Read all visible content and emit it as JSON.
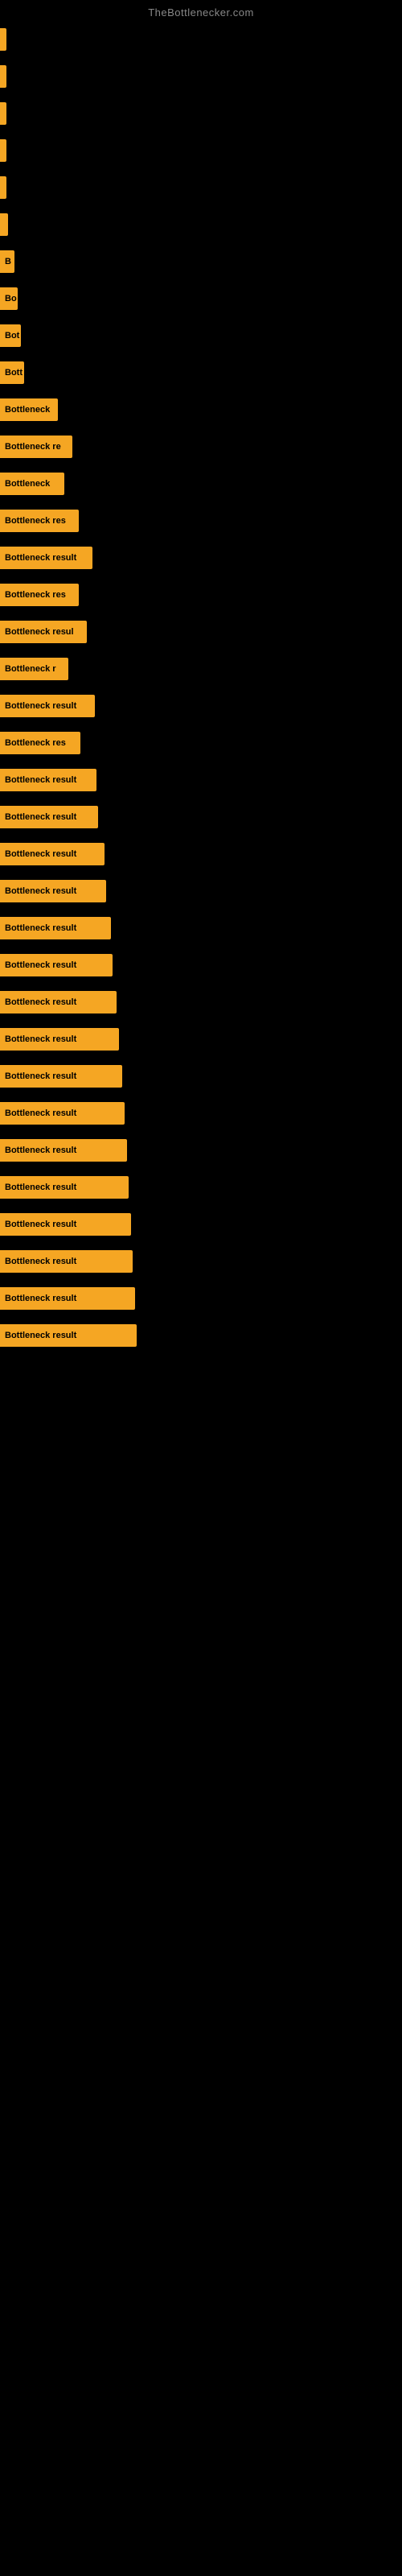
{
  "site": {
    "title": "TheBottlenecker.com"
  },
  "bars": [
    {
      "label": "",
      "width": 8
    },
    {
      "label": "",
      "width": 8
    },
    {
      "label": "",
      "width": 8
    },
    {
      "label": "",
      "width": 8
    },
    {
      "label": "",
      "width": 8
    },
    {
      "label": "",
      "width": 10
    },
    {
      "label": "B",
      "width": 18
    },
    {
      "label": "Bo",
      "width": 22
    },
    {
      "label": "Bot",
      "width": 26
    },
    {
      "label": "Bott",
      "width": 30
    },
    {
      "label": "Bottleneck",
      "width": 72
    },
    {
      "label": "Bottleneck re",
      "width": 90
    },
    {
      "label": "Bottleneck",
      "width": 80
    },
    {
      "label": "Bottleneck res",
      "width": 98
    },
    {
      "label": "Bottleneck result",
      "width": 115
    },
    {
      "label": "Bottleneck res",
      "width": 98
    },
    {
      "label": "Bottleneck resul",
      "width": 108
    },
    {
      "label": "Bottleneck r",
      "width": 85
    },
    {
      "label": "Bottleneck result",
      "width": 118
    },
    {
      "label": "Bottleneck res",
      "width": 100
    },
    {
      "label": "Bottleneck result",
      "width": 120
    },
    {
      "label": "Bottleneck result",
      "width": 122
    },
    {
      "label": "Bottleneck result",
      "width": 130
    },
    {
      "label": "Bottleneck result",
      "width": 132
    },
    {
      "label": "Bottleneck result",
      "width": 138
    },
    {
      "label": "Bottleneck result",
      "width": 140
    },
    {
      "label": "Bottleneck result",
      "width": 145
    },
    {
      "label": "Bottleneck result",
      "width": 148
    },
    {
      "label": "Bottleneck result",
      "width": 152
    },
    {
      "label": "Bottleneck result",
      "width": 155
    },
    {
      "label": "Bottleneck result",
      "width": 158
    },
    {
      "label": "Bottleneck result",
      "width": 160
    },
    {
      "label": "Bottleneck result",
      "width": 163
    },
    {
      "label": "Bottleneck result",
      "width": 165
    },
    {
      "label": "Bottleneck result",
      "width": 168
    },
    {
      "label": "Bottleneck result",
      "width": 170
    }
  ]
}
